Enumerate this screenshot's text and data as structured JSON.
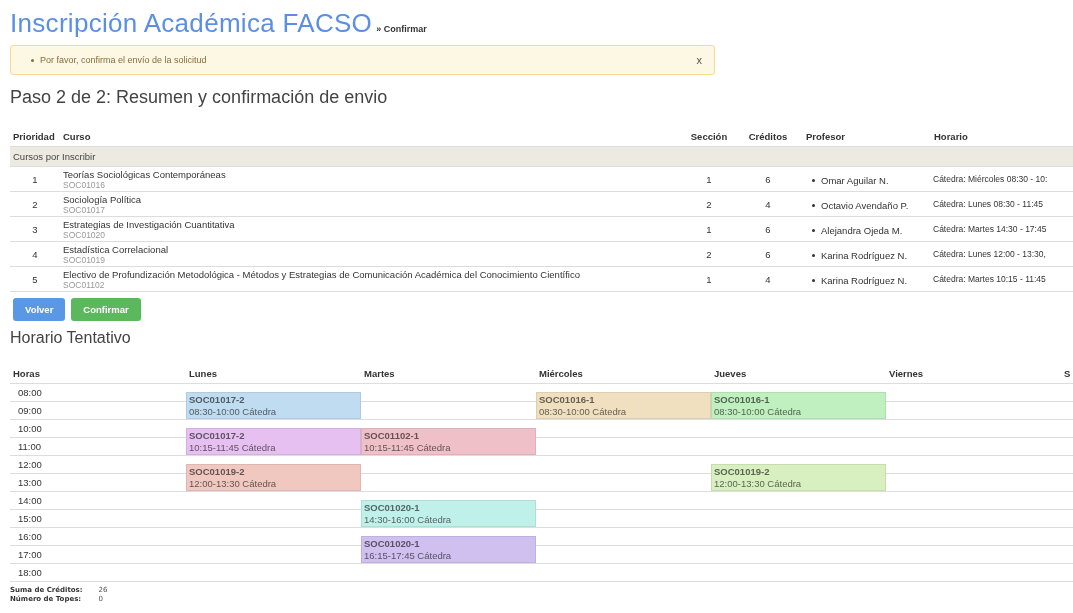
{
  "header": {
    "title": "Inscripción Académica FACSO",
    "breadcrumb": "» Confirmar"
  },
  "alert": {
    "message": "Por favor, confirma el envío de la solicitud",
    "close": "x"
  },
  "step_title": "Paso 2 de 2: Resumen y confirmación de envio",
  "table": {
    "columns": [
      "Prioridad",
      "Curso",
      "Sección",
      "Créditos",
      "Profesor",
      "Horario"
    ],
    "group": "Cursos por Inscribir",
    "rows": [
      {
        "priority": "1",
        "course": "Teorías Sociológicas Contemporáneas",
        "code": "SOC01016",
        "section": "1",
        "credits": "6",
        "professor": "Omar Aguilar N.",
        "schedule": "Cátedra: Miércoles 08:30 - 10:"
      },
      {
        "priority": "2",
        "course": "Sociología Política",
        "code": "SOC01017",
        "section": "2",
        "credits": "4",
        "professor": "Octavio Avendaño P.",
        "schedule": "Cátedra: Lunes 08:30 - 11:45"
      },
      {
        "priority": "3",
        "course": "Estrategias de Investigación Cuantitativa",
        "code": "SOC01020",
        "section": "1",
        "credits": "6",
        "professor": "Alejandra Ojeda M.",
        "schedule": "Cátedra: Martes 14:30 - 17:45"
      },
      {
        "priority": "4",
        "course": "Estadística Correlacional",
        "code": "SOC01019",
        "section": "2",
        "credits": "6",
        "professor": "Karina Rodríguez N.",
        "schedule": "Cátedra: Lunes 12:00 - 13:30,"
      },
      {
        "priority": "5",
        "course": "Electivo de Profundización Metodológica - Métodos y Estrategias de Comunicación Académica del Conocimiento Científico",
        "code": "SOC01102",
        "section": "1",
        "credits": "4",
        "professor": "Karina Rodríguez N.",
        "schedule": "Cátedra: Martes 10:15 - 11:45"
      }
    ]
  },
  "buttons": [
    {
      "label": "Volver",
      "kind": "primary"
    },
    {
      "label": "Confirmar",
      "kind": "success"
    }
  ],
  "schedule_title": "Horario Tentativo",
  "calendar": {
    "hours_label": "Horas",
    "hours": [
      "08:00",
      "09:00",
      "10:00",
      "11:00",
      "12:00",
      "13:00",
      "14:00",
      "15:00",
      "16:00",
      "17:00",
      "18:00"
    ],
    "days": [
      {
        "name": "Lunes",
        "events": [
          {
            "code": "SOC01017-2",
            "time": "08:30-10:00 Cátedra",
            "color": "#c0dcf0"
          },
          {
            "code": "SOC01017-2",
            "time": "10:15-11:45 Cátedra",
            "color": "#e6c0f0"
          },
          {
            "code": "SOC01019-2",
            "time": "12:00-13:30 Cátedra",
            "color": "#f0c8c0"
          }
        ]
      },
      {
        "name": "Martes",
        "events": [
          {
            "code": "SOC01102-1",
            "time": "10:15-11:45 Cátedra",
            "color": "#f0c0c8"
          },
          {
            "code": "SOC01020-1",
            "time": "14:30-16:00 Cátedra",
            "color": "#c0f0ea"
          },
          {
            "code": "SOC01020-1",
            "time": "16:15-17:45 Cátedra",
            "color": "#d0c0f0"
          }
        ]
      },
      {
        "name": "Miércoles",
        "events": [
          {
            "code": "SOC01016-1",
            "time": "08:30-10:00 Cátedra",
            "color": "#f0e0c0"
          }
        ]
      },
      {
        "name": "Jueves",
        "events": [
          {
            "code": "SOC01016-1",
            "time": "08:30-10:00 Cátedra",
            "color": "#c0f0c0"
          },
          {
            "code": "SOC01019-2",
            "time": "12:00-13:30 Cátedra",
            "color": "#d8f0c0"
          }
        ]
      },
      {
        "name": "Viernes"
      },
      {
        "name": "S"
      }
    ]
  },
  "summary": [
    {
      "label": "Suma de Créditos:",
      "value": "26"
    },
    {
      "label": "Número de Topes:",
      "value": "0"
    }
  ]
}
